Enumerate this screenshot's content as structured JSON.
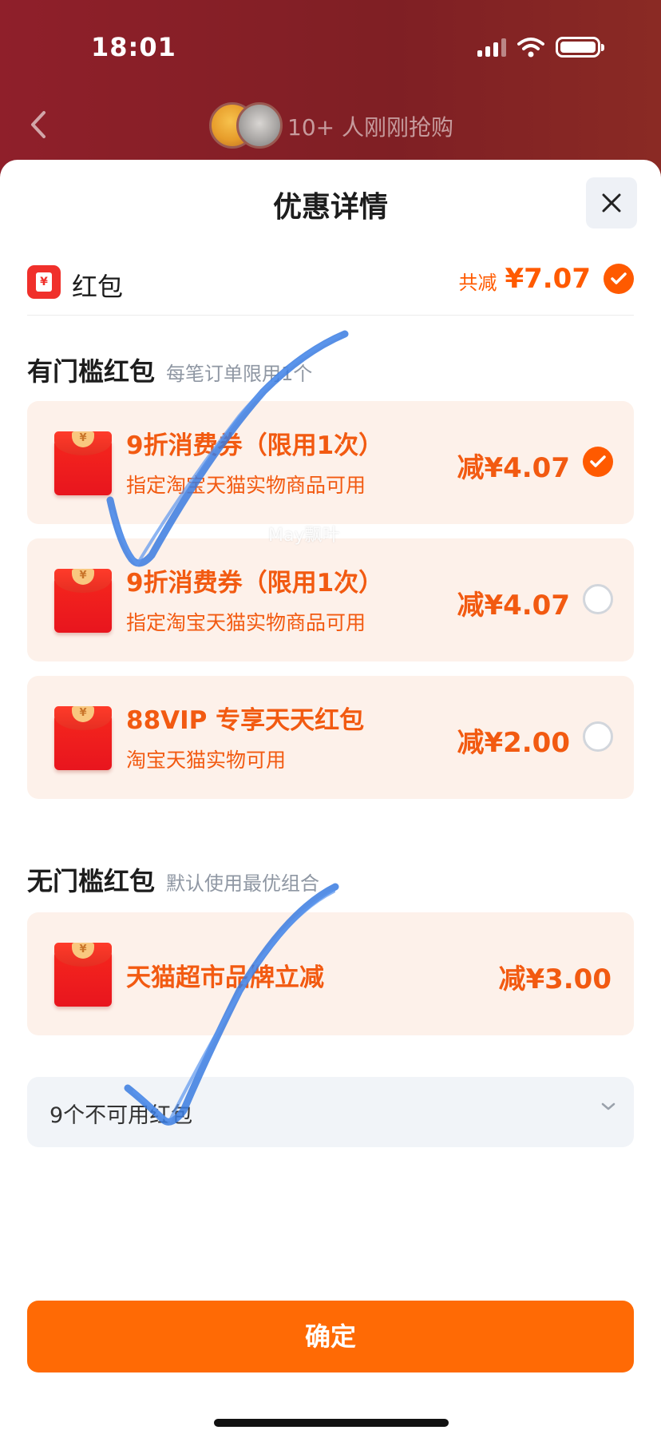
{
  "status_bar": {
    "time": "18:01"
  },
  "nav": {
    "social_proof": "10+ 人刚刚抢购"
  },
  "sheet": {
    "title": "优惠详情"
  },
  "hongbao": {
    "label": "红包",
    "icon_glyph": "¥",
    "total_prefix": "共减",
    "total_value": "¥7.07"
  },
  "threshold_section": {
    "title": "有门槛红包",
    "note": "每笔订单限用1个",
    "coupons": [
      {
        "title": "9折消费券（限用1次）",
        "subtitle": "指定淘宝天猫实物商品可用",
        "amount": "减¥4.07",
        "selected": true
      },
      {
        "title": "9折消费券（限用1次）",
        "subtitle": "指定淘宝天猫实物商品可用",
        "amount": "减¥4.07",
        "selected": false
      },
      {
        "title": "88VIP 专享天天红包",
        "subtitle": "淘宝天猫实物可用",
        "amount": "减¥2.00",
        "selected": false
      }
    ]
  },
  "no_threshold_section": {
    "title": "无门槛红包",
    "note": "默认使用最优组合",
    "coupons": [
      {
        "title": "天猫超市品牌立减",
        "amount": "减¥3.00"
      }
    ]
  },
  "unavailable": {
    "label": "9个不可用红包"
  },
  "confirm_button": {
    "label": "确定"
  },
  "watermark": "May飘叶",
  "colors": {
    "accent": "#ff5a00",
    "header_bg": "#8e2329",
    "coupon_bg": "#fdf1ea",
    "scribble": "#3a7be0"
  }
}
